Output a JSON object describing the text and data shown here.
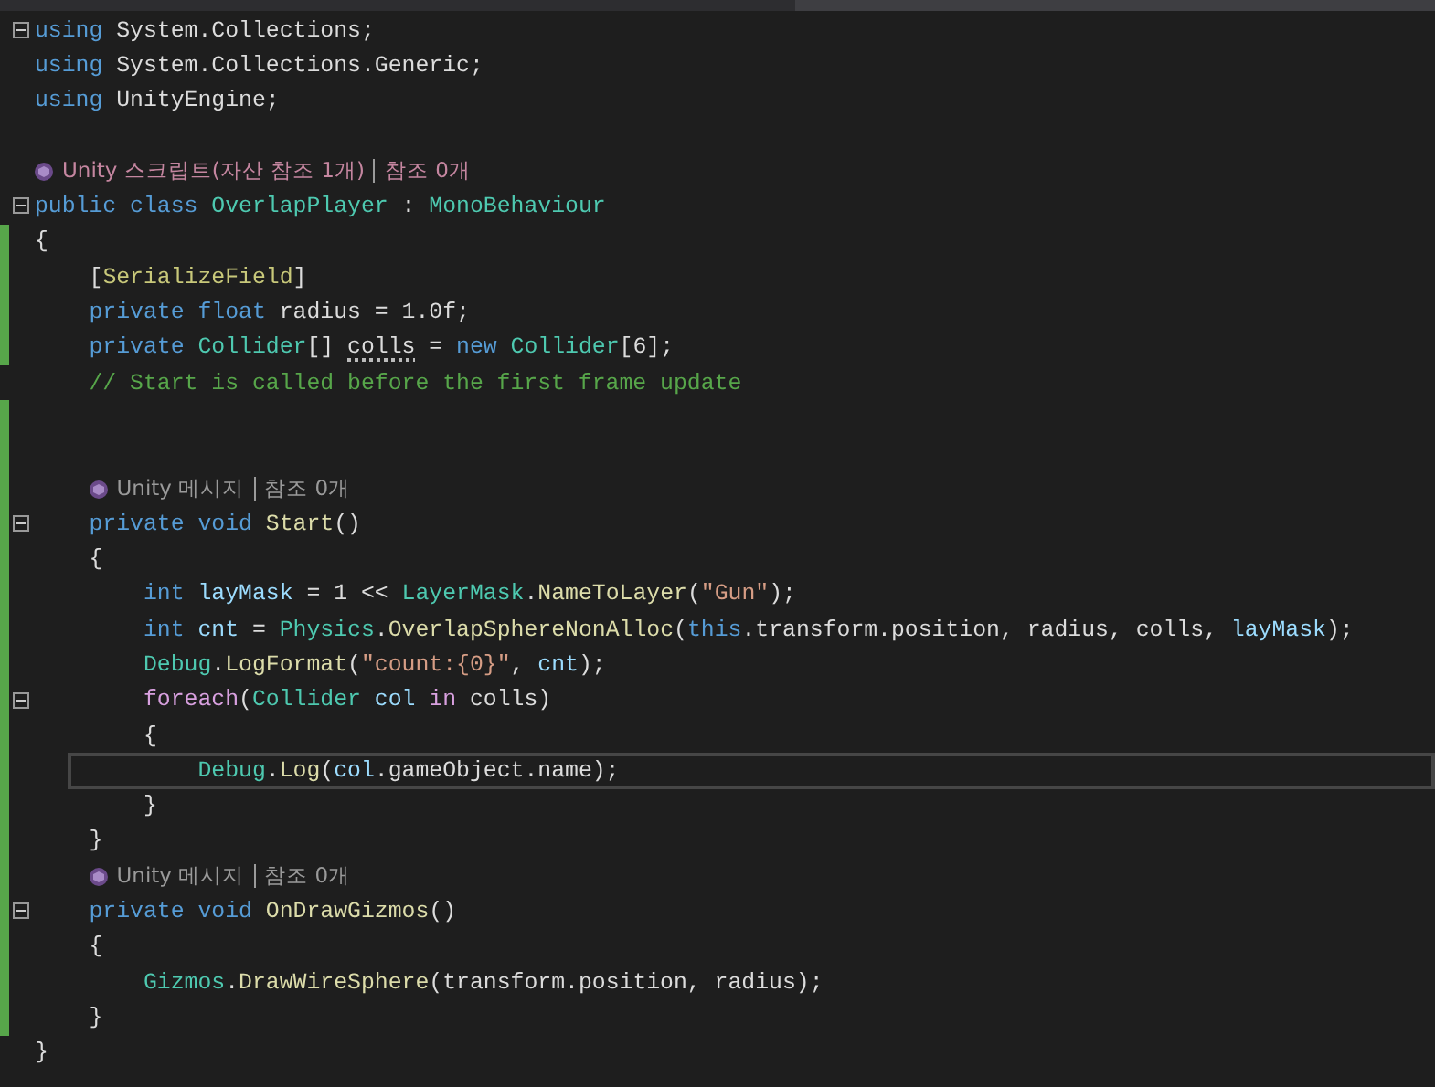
{
  "lines": [
    {
      "kind": "code",
      "changed": false,
      "expanded": true,
      "tokens": [
        {
          "text": "using ",
          "kind": "keyword"
        },
        {
          "text": "System.Collections;",
          "kind": "plain"
        }
      ]
    },
    {
      "kind": "code",
      "changed": false,
      "tokens": [
        {
          "text": "using ",
          "kind": "keyword"
        },
        {
          "text": "System.Collections.Generic;",
          "kind": "plain"
        }
      ]
    },
    {
      "kind": "code",
      "changed": false,
      "tokens": [
        {
          "text": "using ",
          "kind": "keyword"
        },
        {
          "text": "UnityEngine;",
          "kind": "plain"
        }
      ]
    },
    {
      "kind": "blank",
      "changed": false
    },
    {
      "kind": "codelens",
      "changed": false,
      "highlighted": true,
      "parts": [
        "Unity 스크립트(자산 참조 1개)",
        "참조 0개"
      ]
    },
    {
      "kind": "code",
      "changed": false,
      "expanded": true,
      "tokens": [
        {
          "text": "public class ",
          "kind": "keyword"
        },
        {
          "text": "OverlapPlayer",
          "kind": "type"
        },
        {
          "text": " : ",
          "kind": "plain"
        },
        {
          "text": "MonoBehaviour",
          "kind": "type"
        }
      ]
    },
    {
      "kind": "code",
      "changed": true,
      "tokens": [
        {
          "text": "{",
          "kind": "plain"
        }
      ]
    },
    {
      "kind": "code",
      "changed": true,
      "tokens": [
        {
          "text": "    [",
          "kind": "plain"
        },
        {
          "text": "SerializeField",
          "kind": "attribute"
        },
        {
          "text": "]",
          "kind": "plain"
        }
      ]
    },
    {
      "kind": "code",
      "changed": true,
      "tokens": [
        {
          "text": "    private float ",
          "kind": "keyword"
        },
        {
          "text": "radius = 1.0f;",
          "kind": "plain"
        }
      ]
    },
    {
      "kind": "code",
      "changed": true,
      "tokens": [
        {
          "text": "    private ",
          "kind": "keyword"
        },
        {
          "text": "Collider",
          "kind": "type"
        },
        {
          "text": "[] ",
          "kind": "plain"
        },
        {
          "text": "colls",
          "kind": "plain",
          "hint": true
        },
        {
          "text": " = ",
          "kind": "plain"
        },
        {
          "text": "new ",
          "kind": "keyword"
        },
        {
          "text": "Collider",
          "kind": "type"
        },
        {
          "text": "[6];",
          "kind": "plain"
        }
      ]
    },
    {
      "kind": "code",
      "changed": false,
      "tokens": [
        {
          "text": "    // Start is called before the first frame update",
          "kind": "comment"
        }
      ]
    },
    {
      "kind": "blank",
      "changed": true
    },
    {
      "kind": "blank",
      "changed": true
    },
    {
      "kind": "codelens",
      "changed": true,
      "highlighted": false,
      "parts": [
        "Unity 메시지",
        "참조 0개"
      ]
    },
    {
      "kind": "code",
      "changed": true,
      "expanded": true,
      "tokens": [
        {
          "text": "    private void ",
          "kind": "keyword"
        },
        {
          "text": "Start",
          "kind": "method"
        },
        {
          "text": "()",
          "kind": "plain"
        }
      ]
    },
    {
      "kind": "code",
      "changed": true,
      "tokens": [
        {
          "text": "    {",
          "kind": "plain"
        }
      ]
    },
    {
      "kind": "code",
      "changed": true,
      "tokens": [
        {
          "text": "        int ",
          "kind": "keyword"
        },
        {
          "text": "layMask",
          "kind": "variable"
        },
        {
          "text": " = 1 << ",
          "kind": "plain"
        },
        {
          "text": "LayerMask",
          "kind": "type"
        },
        {
          "text": ".",
          "kind": "plain"
        },
        {
          "text": "NameToLayer",
          "kind": "method"
        },
        {
          "text": "(",
          "kind": "plain"
        },
        {
          "text": "\"Gun\"",
          "kind": "string"
        },
        {
          "text": ");",
          "kind": "plain"
        }
      ]
    },
    {
      "kind": "code",
      "changed": true,
      "tokens": [
        {
          "text": "        int ",
          "kind": "keyword"
        },
        {
          "text": "cnt",
          "kind": "variable"
        },
        {
          "text": " = ",
          "kind": "plain"
        },
        {
          "text": "Physics",
          "kind": "type"
        },
        {
          "text": ".",
          "kind": "plain"
        },
        {
          "text": "OverlapSphereNonAlloc",
          "kind": "method"
        },
        {
          "text": "(",
          "kind": "plain"
        },
        {
          "text": "this",
          "kind": "keyword"
        },
        {
          "text": ".transform.position, radius, colls, ",
          "kind": "plain"
        },
        {
          "text": "layMask",
          "kind": "variable"
        },
        {
          "text": ");",
          "kind": "plain"
        }
      ]
    },
    {
      "kind": "code",
      "changed": true,
      "tokens": [
        {
          "text": "        Debug",
          "kind": "type"
        },
        {
          "text": ".",
          "kind": "plain"
        },
        {
          "text": "LogFormat",
          "kind": "method"
        },
        {
          "text": "(",
          "kind": "plain"
        },
        {
          "text": "\"count:{0}\"",
          "kind": "string"
        },
        {
          "text": ", ",
          "kind": "plain"
        },
        {
          "text": "cnt",
          "kind": "variable"
        },
        {
          "text": ");",
          "kind": "plain"
        }
      ]
    },
    {
      "kind": "code",
      "changed": true,
      "expanded": true,
      "tokens": [
        {
          "text": "        foreach",
          "kind": "control"
        },
        {
          "text": "(",
          "kind": "plain"
        },
        {
          "text": "Collider ",
          "kind": "type"
        },
        {
          "text": "col ",
          "kind": "variable"
        },
        {
          "text": "in",
          "kind": "control"
        },
        {
          "text": " colls)",
          "kind": "plain"
        }
      ]
    },
    {
      "kind": "code",
      "changed": true,
      "tokens": [
        {
          "text": "        {",
          "kind": "plain"
        }
      ]
    },
    {
      "kind": "code",
      "changed": true,
      "current": true,
      "tokens": [
        {
          "text": "            Debug",
          "kind": "type"
        },
        {
          "text": ".",
          "kind": "plain"
        },
        {
          "text": "Log",
          "kind": "method"
        },
        {
          "text": "(",
          "kind": "plain"
        },
        {
          "text": "col",
          "kind": "variable"
        },
        {
          "text": ".gameObject.name);",
          "kind": "plain"
        }
      ]
    },
    {
      "kind": "code",
      "changed": true,
      "tokens": [
        {
          "text": "        }",
          "kind": "plain"
        }
      ]
    },
    {
      "kind": "code",
      "changed": true,
      "tokens": [
        {
          "text": "    }",
          "kind": "plain"
        }
      ]
    },
    {
      "kind": "codelens",
      "changed": true,
      "highlighted": false,
      "parts": [
        "Unity 메시지",
        "참조 0개"
      ]
    },
    {
      "kind": "code",
      "changed": true,
      "expanded": true,
      "tokens": [
        {
          "text": "    private void ",
          "kind": "keyword"
        },
        {
          "text": "OnDrawGizmos",
          "kind": "method"
        },
        {
          "text": "()",
          "kind": "plain"
        }
      ]
    },
    {
      "kind": "code",
      "changed": true,
      "tokens": [
        {
          "text": "    {",
          "kind": "plain"
        }
      ]
    },
    {
      "kind": "code",
      "changed": true,
      "tokens": [
        {
          "text": "        Gizmos",
          "kind": "type"
        },
        {
          "text": ".",
          "kind": "plain"
        },
        {
          "text": "DrawWireSphere",
          "kind": "method"
        },
        {
          "text": "(transform.position, radius);",
          "kind": "plain"
        }
      ]
    },
    {
      "kind": "code",
      "changed": true,
      "tokens": [
        {
          "text": "    }",
          "kind": "plain"
        }
      ]
    },
    {
      "kind": "code",
      "changed": false,
      "tokens": [
        {
          "text": "}",
          "kind": "plain"
        }
      ]
    }
  ]
}
